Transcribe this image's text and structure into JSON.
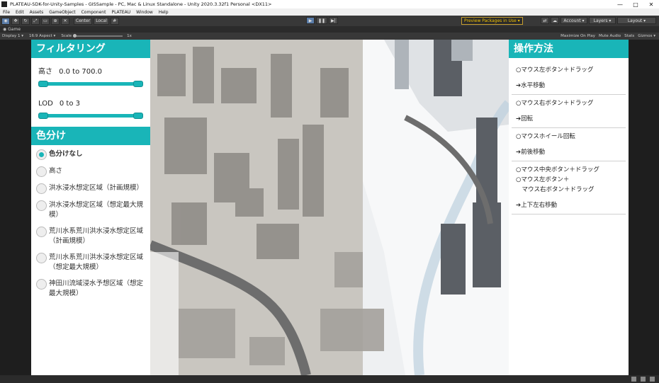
{
  "window": {
    "title": "PLATEAU-SDK-for-Unity-Samples - GISSample - PC, Mac & Linux Standalone - Unity 2020.3.32f1 Personal <DX11>",
    "controls": [
      "—",
      "□",
      "✕"
    ]
  },
  "menu": [
    "File",
    "Edit",
    "Assets",
    "GameObject",
    "Component",
    "PLATEAU",
    "Window",
    "Help"
  ],
  "toolbar": {
    "pivot_label": "Center",
    "space_label": "Local",
    "preview_packages": "Preview Packages in Use ▾",
    "account": "Account ▾",
    "layers": "Layers ▾",
    "layout": "Layout ▾"
  },
  "game_tab": {
    "label": "Game"
  },
  "game_bar": {
    "display": "Display 1 ▾",
    "aspect": "16:9 Aspect ▾",
    "scale_label": "Scale",
    "scale_value": "1x",
    "right_items": [
      "Maximize On Play",
      "Mute Audio",
      "Stats",
      "Gizmos ▾"
    ]
  },
  "filter_panel": {
    "heading": "フィルタリング",
    "height_label": "高さ",
    "height_range": "0.0 to 700.0",
    "lod_label": "LOD",
    "lod_range": "0 to 3"
  },
  "color_panel": {
    "heading": "色分け",
    "options": [
      {
        "label": "色分けなし",
        "checked": true
      },
      {
        "label": "高さ",
        "checked": false
      },
      {
        "label": "洪水浸水想定区域（計画規模）",
        "checked": false
      },
      {
        "label": "洪水浸水想定区域（想定最大規模）",
        "checked": false
      },
      {
        "label": "荒川水系荒川洪水浸水想定区域（計画規模）",
        "checked": false
      },
      {
        "label": "荒川水系荒川洪水浸水想定区域（想定最大規模）",
        "checked": false
      },
      {
        "label": "神田川流域浸水予想区域（想定最大規模）",
        "checked": false
      }
    ]
  },
  "controls_panel": {
    "heading": "操作方法",
    "groups": [
      {
        "lines": [
          "○マウス左ボタン＋ドラッグ"
        ],
        "result": "➔水平移動"
      },
      {
        "lines": [
          "○マウス右ボタン＋ドラッグ"
        ],
        "result": "➔回転"
      },
      {
        "lines": [
          "○マウスホイール回転"
        ],
        "result": "➔前後移動"
      },
      {
        "lines": [
          "○マウス中央ボタン＋ドラッグ",
          "○マウス左ボタン＋",
          "　マウス右ボタン＋ドラッグ"
        ],
        "result": "➔上下左右移動"
      }
    ]
  },
  "colors": {
    "accent": "#19b5b8",
    "editor_bg": "#383838"
  }
}
